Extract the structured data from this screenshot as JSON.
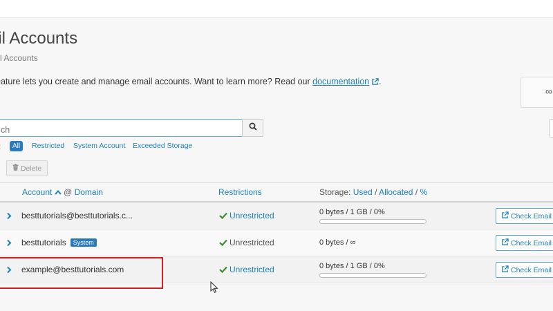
{
  "page": {
    "title": "ail Accounts",
    "breadcrumb": "nail Accounts",
    "description_prefix": "eature lets you create and manage email accounts. Want to learn more? Read our ",
    "documentation_link": "documentation",
    "description_suffix": "."
  },
  "stats_card": {
    "symbol": "∞"
  },
  "search": {
    "placeholder": "ch"
  },
  "filters": {
    "colon": ":",
    "items": [
      "All",
      "Restricted",
      "System Account",
      "Exceeded Storage"
    ],
    "active": "All"
  },
  "toolbar": {
    "delete_label": "Delete"
  },
  "table": {
    "headers": {
      "account": "Account",
      "at": "@",
      "domain": "Domain",
      "restrictions": "Restrictions",
      "storage_prefix": "Storage:",
      "used": "Used",
      "sep1": "/",
      "allocated": "Allocated",
      "sep2": "/",
      "percent": "%"
    },
    "rows": [
      {
        "account": "besttutorials@besttutorials.c...",
        "restriction": "Unrestricted",
        "storage": "0 bytes / 1 GB / 0%",
        "storage_fraction": 0,
        "action": "Check Email"
      },
      {
        "account": "besttutorials",
        "badge": "System",
        "restriction": "Unrestricted",
        "storage": "0 bytes / ∞",
        "action": "Check Email"
      },
      {
        "account": "example@besttutorials.com",
        "restriction": "Unrestricted",
        "storage": "0 bytes / 1 GB / 0%",
        "storage_fraction": 0,
        "action": "Check Email"
      }
    ]
  },
  "colors": {
    "accent": "#1b7fb8",
    "badge": "#2a7bbd",
    "success": "#3c8a2e",
    "highlight": "#d02020"
  },
  "icons": [
    "external-link-icon",
    "search-icon",
    "trash-icon",
    "sort-up-icon",
    "chevron-right-icon",
    "check-icon",
    "cursor-icon"
  ]
}
